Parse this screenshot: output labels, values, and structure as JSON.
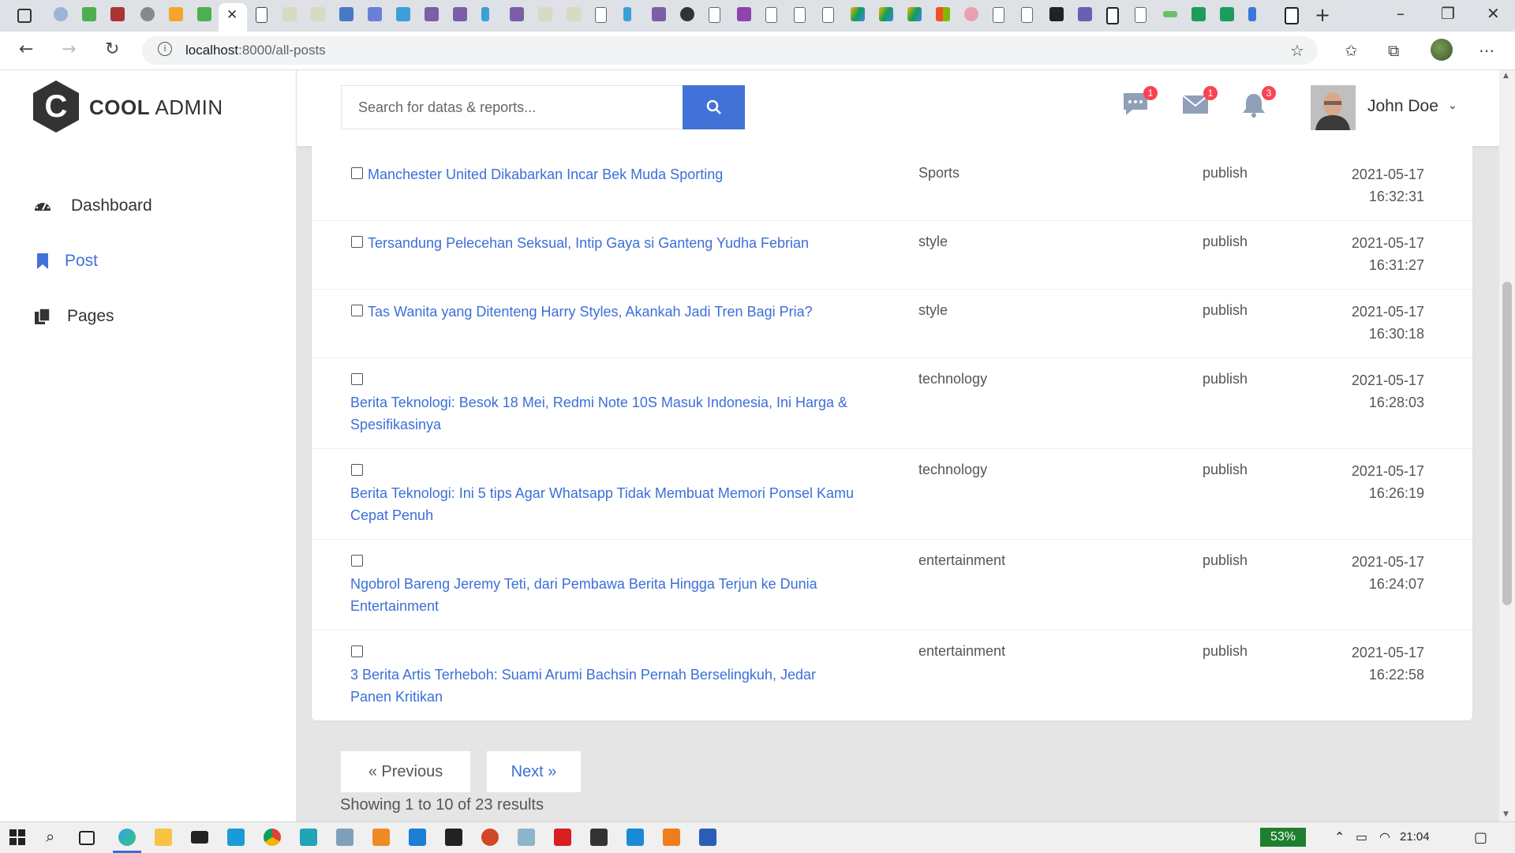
{
  "browser": {
    "url_host": "localhost",
    "url_path": ":8000/all-posts"
  },
  "app": {
    "logo_bold": "COOL",
    "logo_light": "ADMIN",
    "search_placeholder": "Search for datas & reports...",
    "notifications": {
      "chat_count": "1",
      "mail_count": "1",
      "bell_count": "3"
    },
    "user_name": "John Doe"
  },
  "sidebar": {
    "items": [
      {
        "label": "Dashboard",
        "icon": "tachometer-icon"
      },
      {
        "label": "Post",
        "icon": "bookmark-icon"
      },
      {
        "label": "Pages",
        "icon": "copy-icon"
      }
    ]
  },
  "posts": [
    {
      "title": "Manchester United Dikabarkan Incar Bek Muda Sporting",
      "category": "Sports",
      "status": "publish",
      "date": "2021-05-17",
      "time": "16:32:31"
    },
    {
      "title": "Tersandung Pelecehan Seksual, Intip Gaya si Ganteng Yudha Febrian",
      "category": "style",
      "status": "publish",
      "date": "2021-05-17",
      "time": "16:31:27"
    },
    {
      "title": "Tas Wanita yang Ditenteng Harry Styles, Akankah Jadi Tren Bagi Pria?",
      "category": "style",
      "status": "publish",
      "date": "2021-05-17",
      "time": "16:30:18"
    },
    {
      "title": "Berita Teknologi: Besok 18 Mei, Redmi Note 10S Masuk Indonesia, Ini Harga & Spesifikasinya",
      "category": "technology",
      "status": "publish",
      "date": "2021-05-17",
      "time": "16:28:03"
    },
    {
      "title": "Berita Teknologi: Ini 5 tips Agar Whatsapp Tidak Membuat Memori Ponsel Kamu Cepat Penuh",
      "category": "technology",
      "status": "publish",
      "date": "2021-05-17",
      "time": "16:26:19"
    },
    {
      "title": "Ngobrol Bareng Jeremy Teti, dari Pembawa Berita Hingga Terjun ke Dunia Entertainment",
      "category": "entertainment",
      "status": "publish",
      "date": "2021-05-17",
      "time": "16:24:07"
    },
    {
      "title": "3 Berita Artis Terheboh: Suami Arumi Bachsin Pernah Berselingkuh, Jedar Panen Kritikan",
      "category": "entertainment",
      "status": "publish",
      "date": "2021-05-17",
      "time": "16:22:58"
    }
  ],
  "pagination": {
    "prev_label": "« Previous",
    "next_label": "Next »",
    "showing_text": "Showing 1 to 10 of 23 results"
  },
  "taskbar": {
    "battery": "53%",
    "clock": "21:04"
  },
  "colors": {
    "accent": "#4272d7",
    "link": "#3b6fd8",
    "badge": "#fa4251",
    "battery": "#1e7f2e"
  }
}
